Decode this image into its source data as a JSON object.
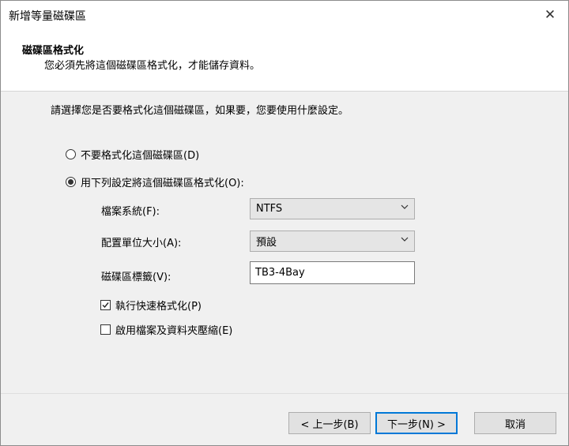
{
  "window": {
    "title": "新增等量磁碟區",
    "close_glyph": "✕"
  },
  "header": {
    "title": "磁碟區格式化",
    "subtitle": "您必須先將這個磁碟區格式化，才能儲存資料。"
  },
  "content": {
    "prompt": "請選擇您是否要格式化這個磁碟區，如果要，您要使用什麼設定。",
    "radio_no_format": {
      "label": "不要格式化這個磁碟區(D)",
      "checked": false
    },
    "radio_format": {
      "label": "用下列設定將這個磁碟區格式化(O):",
      "checked": true
    },
    "file_system": {
      "label": "檔案系統(F):",
      "value": "NTFS"
    },
    "allocation_unit": {
      "label": "配置單位大小(A):",
      "value": "預設"
    },
    "volume_label": {
      "label": "磁碟區標籤(V):",
      "value": "TB3-4Bay"
    },
    "quick_format": {
      "label": "執行快速格式化(P)",
      "checked": true
    },
    "compression": {
      "label": "啟用檔案及資料夾壓縮(E)",
      "checked": false
    }
  },
  "footer": {
    "back_label": "< 上一步(B)",
    "next_label": "下一步(N) >",
    "cancel_label": "取消"
  },
  "colors": {
    "default_button_border": "#0078d7",
    "dialog_background": "#f0f0f0"
  }
}
